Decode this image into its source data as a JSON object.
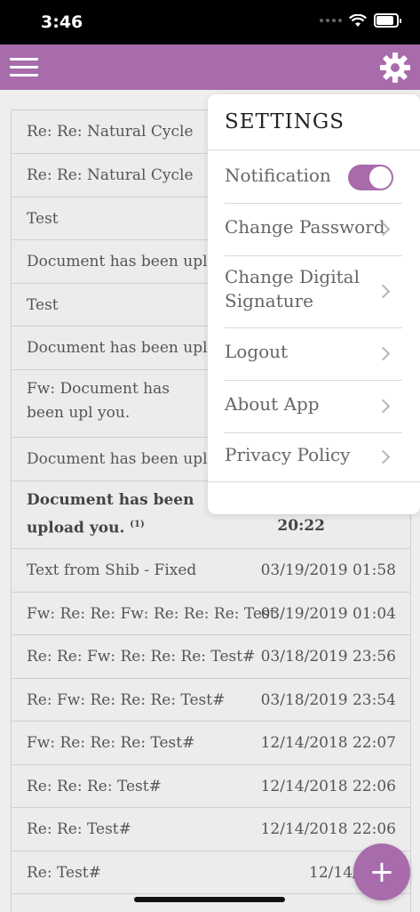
{
  "status_bar": {
    "time": "3:46"
  },
  "app_bar": {
    "menu_icon": "hamburger-icon",
    "settings_icon": "gear-icon"
  },
  "colors": {
    "accent": "#a86cac",
    "status_bar": "#000000",
    "list_bg": "#ececec"
  },
  "messages": [
    {
      "subject": "Re: Re: Natural Cycle",
      "date": ""
    },
    {
      "subject": "Re: Re: Natural Cycle",
      "date": ""
    },
    {
      "subject": "Test",
      "date": ""
    },
    {
      "subject": "Document has been uploade",
      "date": ""
    },
    {
      "subject": "Test",
      "date": ""
    },
    {
      "subject": "Document has been uploade",
      "date": ""
    },
    {
      "subject": "Fw: Document has been upl you.",
      "date": ""
    },
    {
      "subject": "Document has been uploade",
      "date": ""
    },
    {
      "subject": "Document has been upload you.",
      "badge": "(1)",
      "date": "20:22"
    },
    {
      "subject": "Text from Shib - Fixed",
      "date": "03/19/2019 01:58"
    },
    {
      "subject": "Fw: Re: Re: Fw: Re: Re: Re: Test#",
      "date": "03/19/2019 01:04"
    },
    {
      "subject": "Re: Re: Fw: Re: Re: Re: Test#",
      "date": "03/18/2019 23:56"
    },
    {
      "subject": "Re: Fw: Re: Re: Re: Test#",
      "date": "03/18/2019 23:54"
    },
    {
      "subject": "Fw: Re: Re: Re: Test#",
      "date": "12/14/2018 22:07"
    },
    {
      "subject": "Re: Re: Re: Test#",
      "date": "12/14/2018 22:06"
    },
    {
      "subject": "Re: Re: Test#",
      "date": "12/14/2018 22:06"
    },
    {
      "subject": "Re: Test#",
      "date": "12/14/2018"
    }
  ],
  "settings_menu": {
    "title": "SETTINGS",
    "notification_label": "Notification",
    "notification_on": true,
    "items": [
      {
        "label": "Change Password"
      },
      {
        "label": "Change Digital Signature"
      },
      {
        "label": "Logout"
      },
      {
        "label": "About App"
      },
      {
        "label": "Privacy Policy"
      }
    ]
  },
  "fab": {
    "label": "+"
  }
}
